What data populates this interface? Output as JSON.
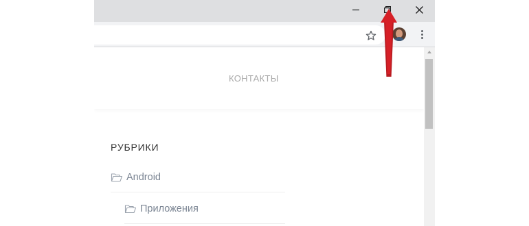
{
  "window": {
    "controls": {
      "minimize_icon": "minimize-icon",
      "restore_icon": "restore-down-icon",
      "close_icon": "close-icon"
    }
  },
  "toolbar": {
    "bookmark_icon": "star-icon",
    "profile_icon": "avatar",
    "menu_icon": "three-dots-menu-icon"
  },
  "page": {
    "nav": {
      "contacts": "КОНТАКТЫ"
    },
    "sidebar": {
      "title": "РУБРИКИ",
      "categories": [
        {
          "label": "Android",
          "icon": "folder-open-icon"
        },
        {
          "label": "Приложения",
          "icon": "folder-open-icon"
        }
      ]
    }
  },
  "annotation": {
    "color": "#d62027",
    "icon": "red-arrow"
  },
  "colors": {
    "titlebar": "#dedfe1",
    "toolbar": "#f2f3f5",
    "link_text": "#7b8593",
    "nav_text": "#a9a9a9",
    "heading_text": "#333333"
  }
}
